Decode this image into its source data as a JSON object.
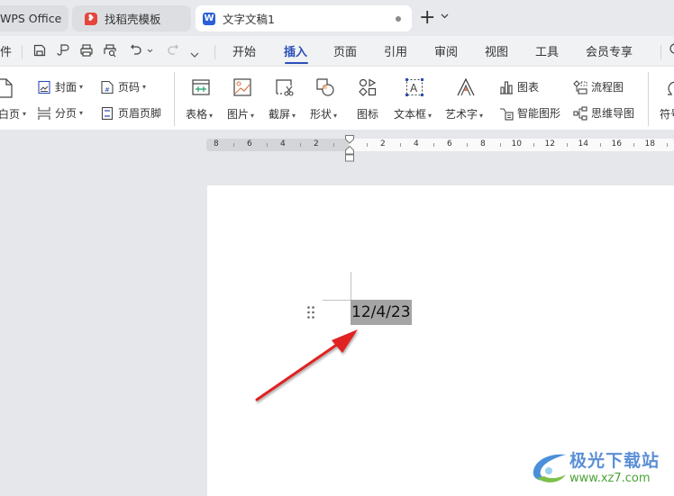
{
  "tabs": [
    {
      "label": "WPS Office",
      "state": "inactive"
    },
    {
      "label": "找稻壳模板",
      "state": "inactive",
      "icon": "docer-icon"
    },
    {
      "label": "文字文稿1",
      "state": "active",
      "icon": "word-doc-icon",
      "unsaved": true
    }
  ],
  "tabbar": {
    "new_tab": "+",
    "new_tab_menu": "⌄"
  },
  "menubar": {
    "file_label": "件",
    "items": [
      "开始",
      "插入",
      "页面",
      "引用",
      "审阅",
      "视图",
      "工具",
      "会员专享"
    ],
    "active": "插入"
  },
  "ribbon": {
    "blank_page": "白页",
    "cover": "封面",
    "page_number": "页码",
    "page_break": "分页",
    "header_footer": "页眉页脚",
    "table": "表格",
    "picture": "图片",
    "screenshot": "截屏",
    "shape": "形状",
    "icon": "图标",
    "textbox": "文本框",
    "wordart": "艺术字",
    "chart": "图表",
    "smartart": "智能图形",
    "flowchart": "流程图",
    "mindmap": "思维导图",
    "symbol": "符号"
  },
  "ruler": {
    "left_numbers": [
      "8",
      "6",
      "4",
      "2"
    ],
    "right_numbers": [
      "2",
      "4",
      "6",
      "8",
      "10",
      "12",
      "14",
      "16",
      "18"
    ]
  },
  "document": {
    "selected_text": "12/4/23"
  },
  "annotation": {
    "arrow_color": "#e02020"
  },
  "watermark": {
    "title": "极光下载站",
    "url": "www.xz7.com"
  },
  "colors": {
    "accent": "#2b4fb8",
    "selection": "#a5a5a5"
  }
}
